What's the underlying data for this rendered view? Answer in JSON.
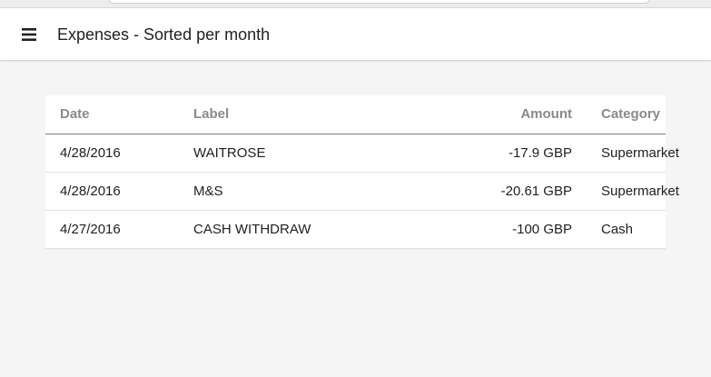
{
  "app_bar": {
    "title": "Expenses - Sorted per month",
    "menu_icon": "hamburger-menu-icon"
  },
  "table": {
    "headers": {
      "date": "Date",
      "label": "Label",
      "amount": "Amount",
      "category": "Category"
    },
    "rows": [
      {
        "date": "4/28/2016",
        "label": "WAITROSE",
        "amount": "-17.9 GBP",
        "category": "Supermarket"
      },
      {
        "date": "4/28/2016",
        "label": "M&S",
        "amount": "-20.61 GBP",
        "category": "Supermarket"
      },
      {
        "date": "4/27/2016",
        "label": "CASH WITHDRAW",
        "amount": "-100 GBP",
        "category": "Cash"
      }
    ]
  },
  "colors": {
    "background": "#f5f5f5",
    "app_bar": "#ffffff",
    "header_text": "#8a8a8a",
    "body_text": "#212121"
  }
}
